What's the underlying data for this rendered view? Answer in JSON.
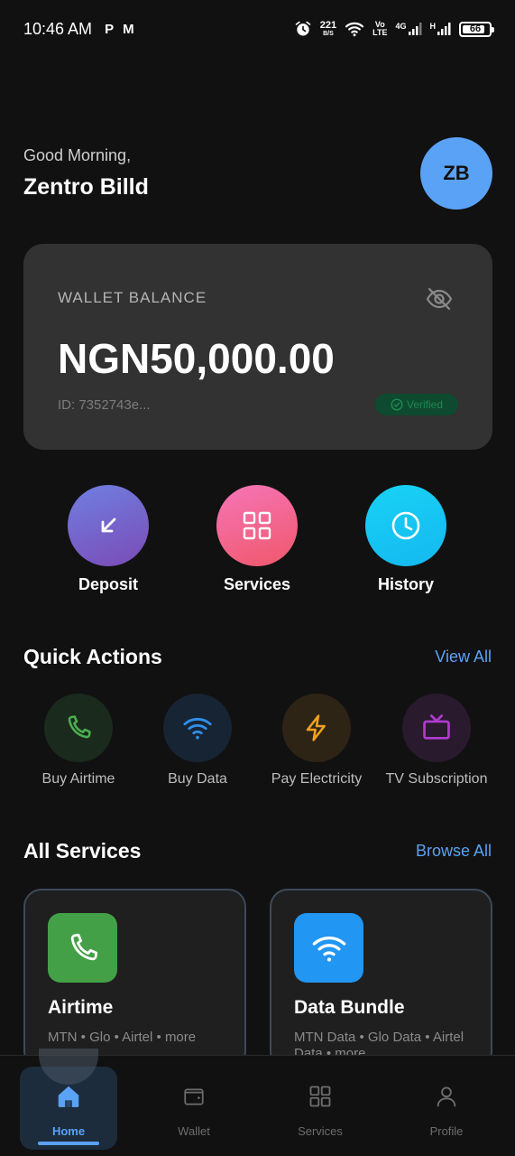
{
  "status_bar": {
    "time": "10:46 AM",
    "left_icons": [
      "P",
      "M"
    ],
    "net_speed_value": "221",
    "net_speed_unit": "B/S",
    "volte_top": "Vo",
    "volte_bottom": "LTE",
    "network_4g": "4G",
    "network_h": "H",
    "battery": "66",
    "icons": [
      "alarm-icon",
      "wifi-icon",
      "signal-icon",
      "battery-icon"
    ]
  },
  "header": {
    "greeting": "Good Morning,",
    "user_name": "Zentro Billd",
    "avatar_initials": "ZB"
  },
  "balance_card": {
    "label": "WALLET BALANCE",
    "amount": "NGN50,000.00",
    "wallet_id": "ID: 7352743e...",
    "verified_label": "Verified"
  },
  "primary_actions": [
    {
      "label": "Deposit",
      "icon": "arrow-down-left-icon",
      "colors": [
        "#6f7fe0",
        "#7b4bb7"
      ]
    },
    {
      "label": "Services",
      "icon": "grid-icon",
      "colors": [
        "#f576b8",
        "#f0576a"
      ]
    },
    {
      "label": "History",
      "icon": "clock-icon",
      "colors": [
        "#19d2f5",
        "#14b8f0"
      ]
    }
  ],
  "quick_actions": {
    "title": "Quick Actions",
    "link": "View All",
    "items": [
      {
        "label": "Buy Airtime",
        "icon": "phone-icon",
        "color": "#4caf50",
        "bg": "#1a2a1c"
      },
      {
        "label": "Buy Data",
        "icon": "wifi-icon",
        "color": "#2f8fe8",
        "bg": "#172433"
      },
      {
        "label": "Pay Electricity",
        "icon": "lightning-icon",
        "color": "#f0a020",
        "bg": "#2e2416"
      },
      {
        "label": "TV Subscription",
        "icon": "tv-icon",
        "color": "#b03ccf",
        "bg": "#2a1a2e"
      }
    ]
  },
  "all_services": {
    "title": "All Services",
    "link": "Browse All",
    "cards": [
      {
        "title": "Airtime",
        "desc": "MTN • Glo • Airtel • more",
        "icon": "phone-icon",
        "color": "#43a047"
      },
      {
        "title": "Data Bundle",
        "desc": "MTN Data • Glo Data • Airtel Data • more",
        "icon": "wifi-icon",
        "color": "#2196f3"
      }
    ]
  },
  "bottom_nav": {
    "items": [
      {
        "label": "Home",
        "icon": "home-icon",
        "active": true
      },
      {
        "label": "Wallet",
        "icon": "wallet-icon",
        "active": false
      },
      {
        "label": "Services",
        "icon": "grid-icon",
        "active": false
      },
      {
        "label": "Profile",
        "icon": "user-icon",
        "active": false
      }
    ],
    "active_color": "#5aa2f5"
  }
}
